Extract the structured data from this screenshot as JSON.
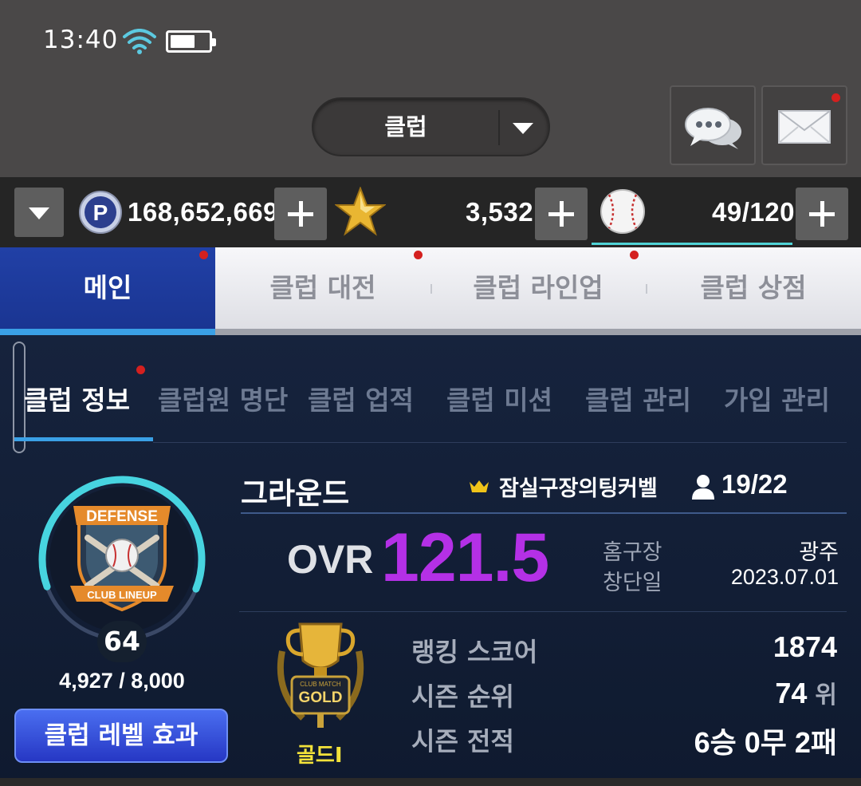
{
  "status_bar": {
    "time": "13:40"
  },
  "header": {
    "club_selector": "클럽"
  },
  "currency": {
    "points": "168,652,669",
    "stars": "3,532",
    "balls": "49/120"
  },
  "main_tabs": [
    {
      "label": "메인",
      "active": true
    },
    {
      "label": "클럽 대전",
      "active": false
    },
    {
      "label": "클럽 라인업",
      "active": false
    },
    {
      "label": "클럽 상점",
      "active": false
    }
  ],
  "sub_tabs": [
    {
      "label": "클럽 정보",
      "active": true
    },
    {
      "label": "클럽원 명단",
      "active": false
    },
    {
      "label": "클럽 업적",
      "active": false
    },
    {
      "label": "클럽 미션",
      "active": false
    },
    {
      "label": "클럽 관리",
      "active": false
    },
    {
      "label": "가입 관리",
      "active": false
    }
  ],
  "club": {
    "name": "그라운드",
    "leader": "잠실구장의팅커벨",
    "members": "19/22",
    "level": "64",
    "exp": "4,927 / 8,000",
    "exp_fraction": 0.616,
    "level_button": "클럽 레벨 효과",
    "ovr_label": "OVR",
    "ovr_value": "121.5",
    "home_label": "홈구장",
    "home_value": "광주",
    "founded_label": "창단일",
    "founded_value": "2023.07.01",
    "tier_name": "골드Ⅰ",
    "ranking_score_label": "랭킹 스코어",
    "ranking_score_value": "1874",
    "season_rank_label": "시즌 순위",
    "season_rank_value": "74",
    "season_rank_unit": "위",
    "season_record_label": "시즌 전적",
    "season_record_value": "6승 0무 2패"
  },
  "emblem": {
    "top_text": "DEFENSE",
    "bottom_text": "CLUB LINEUP"
  },
  "trophy": {
    "small_text": "CLUB MATCH",
    "text": "GOLD"
  },
  "colors": {
    "accent_blue": "#2140a6",
    "ovr_purple": "#b430e6",
    "ring_cyan": "#47d4e0",
    "tier_gold": "#f2e23a",
    "notify_red": "#d4201f"
  }
}
